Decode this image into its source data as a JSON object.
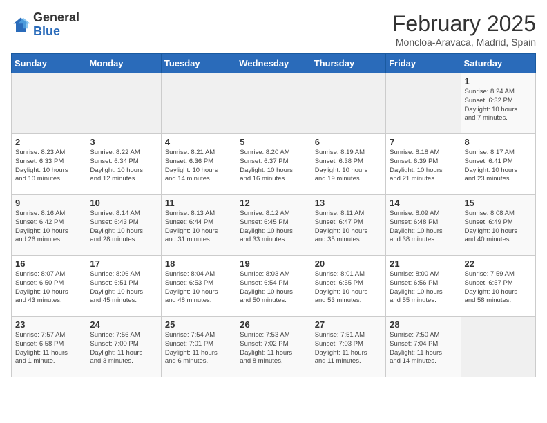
{
  "logo": {
    "general": "General",
    "blue": "Blue"
  },
  "header": {
    "month": "February 2025",
    "location": "Moncloa-Aravaca, Madrid, Spain"
  },
  "weekdays": [
    "Sunday",
    "Monday",
    "Tuesday",
    "Wednesday",
    "Thursday",
    "Friday",
    "Saturday"
  ],
  "weeks": [
    [
      {
        "day": "",
        "info": ""
      },
      {
        "day": "",
        "info": ""
      },
      {
        "day": "",
        "info": ""
      },
      {
        "day": "",
        "info": ""
      },
      {
        "day": "",
        "info": ""
      },
      {
        "day": "",
        "info": ""
      },
      {
        "day": "1",
        "info": "Sunrise: 8:24 AM\nSunset: 6:32 PM\nDaylight: 10 hours\nand 7 minutes."
      }
    ],
    [
      {
        "day": "2",
        "info": "Sunrise: 8:23 AM\nSunset: 6:33 PM\nDaylight: 10 hours\nand 10 minutes."
      },
      {
        "day": "3",
        "info": "Sunrise: 8:22 AM\nSunset: 6:34 PM\nDaylight: 10 hours\nand 12 minutes."
      },
      {
        "day": "4",
        "info": "Sunrise: 8:21 AM\nSunset: 6:36 PM\nDaylight: 10 hours\nand 14 minutes."
      },
      {
        "day": "5",
        "info": "Sunrise: 8:20 AM\nSunset: 6:37 PM\nDaylight: 10 hours\nand 16 minutes."
      },
      {
        "day": "6",
        "info": "Sunrise: 8:19 AM\nSunset: 6:38 PM\nDaylight: 10 hours\nand 19 minutes."
      },
      {
        "day": "7",
        "info": "Sunrise: 8:18 AM\nSunset: 6:39 PM\nDaylight: 10 hours\nand 21 minutes."
      },
      {
        "day": "8",
        "info": "Sunrise: 8:17 AM\nSunset: 6:41 PM\nDaylight: 10 hours\nand 23 minutes."
      }
    ],
    [
      {
        "day": "9",
        "info": "Sunrise: 8:16 AM\nSunset: 6:42 PM\nDaylight: 10 hours\nand 26 minutes."
      },
      {
        "day": "10",
        "info": "Sunrise: 8:14 AM\nSunset: 6:43 PM\nDaylight: 10 hours\nand 28 minutes."
      },
      {
        "day": "11",
        "info": "Sunrise: 8:13 AM\nSunset: 6:44 PM\nDaylight: 10 hours\nand 31 minutes."
      },
      {
        "day": "12",
        "info": "Sunrise: 8:12 AM\nSunset: 6:45 PM\nDaylight: 10 hours\nand 33 minutes."
      },
      {
        "day": "13",
        "info": "Sunrise: 8:11 AM\nSunset: 6:47 PM\nDaylight: 10 hours\nand 35 minutes."
      },
      {
        "day": "14",
        "info": "Sunrise: 8:09 AM\nSunset: 6:48 PM\nDaylight: 10 hours\nand 38 minutes."
      },
      {
        "day": "15",
        "info": "Sunrise: 8:08 AM\nSunset: 6:49 PM\nDaylight: 10 hours\nand 40 minutes."
      }
    ],
    [
      {
        "day": "16",
        "info": "Sunrise: 8:07 AM\nSunset: 6:50 PM\nDaylight: 10 hours\nand 43 minutes."
      },
      {
        "day": "17",
        "info": "Sunrise: 8:06 AM\nSunset: 6:51 PM\nDaylight: 10 hours\nand 45 minutes."
      },
      {
        "day": "18",
        "info": "Sunrise: 8:04 AM\nSunset: 6:53 PM\nDaylight: 10 hours\nand 48 minutes."
      },
      {
        "day": "19",
        "info": "Sunrise: 8:03 AM\nSunset: 6:54 PM\nDaylight: 10 hours\nand 50 minutes."
      },
      {
        "day": "20",
        "info": "Sunrise: 8:01 AM\nSunset: 6:55 PM\nDaylight: 10 hours\nand 53 minutes."
      },
      {
        "day": "21",
        "info": "Sunrise: 8:00 AM\nSunset: 6:56 PM\nDaylight: 10 hours\nand 55 minutes."
      },
      {
        "day": "22",
        "info": "Sunrise: 7:59 AM\nSunset: 6:57 PM\nDaylight: 10 hours\nand 58 minutes."
      }
    ],
    [
      {
        "day": "23",
        "info": "Sunrise: 7:57 AM\nSunset: 6:58 PM\nDaylight: 11 hours\nand 1 minute."
      },
      {
        "day": "24",
        "info": "Sunrise: 7:56 AM\nSunset: 7:00 PM\nDaylight: 11 hours\nand 3 minutes."
      },
      {
        "day": "25",
        "info": "Sunrise: 7:54 AM\nSunset: 7:01 PM\nDaylight: 11 hours\nand 6 minutes."
      },
      {
        "day": "26",
        "info": "Sunrise: 7:53 AM\nSunset: 7:02 PM\nDaylight: 11 hours\nand 8 minutes."
      },
      {
        "day": "27",
        "info": "Sunrise: 7:51 AM\nSunset: 7:03 PM\nDaylight: 11 hours\nand 11 minutes."
      },
      {
        "day": "28",
        "info": "Sunrise: 7:50 AM\nSunset: 7:04 PM\nDaylight: 11 hours\nand 14 minutes."
      },
      {
        "day": "",
        "info": ""
      }
    ]
  ]
}
